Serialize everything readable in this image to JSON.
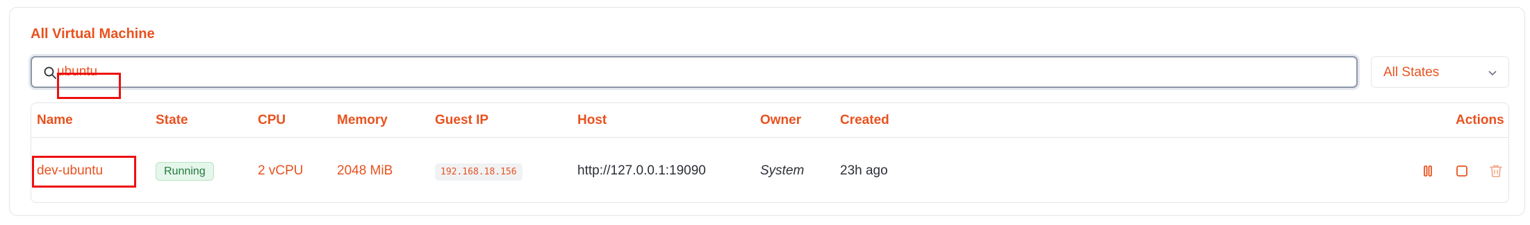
{
  "page": {
    "title": "All Virtual Machine"
  },
  "search": {
    "value": "ubuntu",
    "placeholder": ""
  },
  "filter": {
    "selected": "All States"
  },
  "table": {
    "columns": [
      "Name",
      "State",
      "CPU",
      "Memory",
      "Guest IP",
      "Host",
      "Owner",
      "Created",
      "Actions"
    ],
    "rows": [
      {
        "name": "dev-ubuntu",
        "state": "Running",
        "cpu": "2 vCPU",
        "memory": "2048 MiB",
        "guest_ip": "192.168.18.156",
        "host": "http://127.0.0.1:19090",
        "owner": "System",
        "created": "23h ago",
        "actions": [
          "pause-icon",
          "stop-icon",
          "trash-icon"
        ]
      }
    ]
  },
  "colors": {
    "accent": "#e8521f",
    "running_bg": "#e5f6ea",
    "running_text": "#1f7a3d",
    "highlight": "#ee0f0f"
  }
}
